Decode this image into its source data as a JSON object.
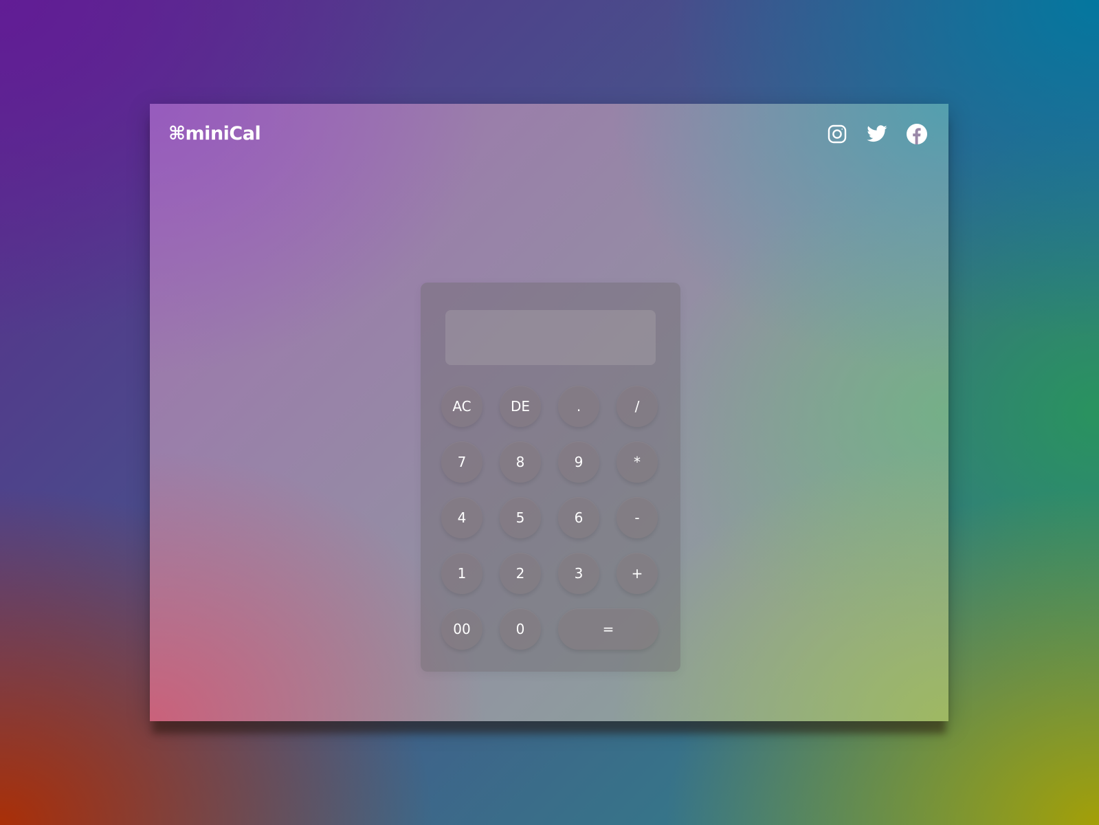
{
  "header": {
    "brand": "⌘miniCal",
    "social": [
      {
        "name": "instagram-icon"
      },
      {
        "name": "twitter-icon"
      },
      {
        "name": "facebook-icon"
      }
    ]
  },
  "calculator": {
    "display_value": "",
    "keys": {
      "ac": "AC",
      "de": "DE",
      "dot": ".",
      "divide": "/",
      "seven": "7",
      "eight": "8",
      "nine": "9",
      "multiply": "*",
      "four": "4",
      "five": "5",
      "six": "6",
      "minus": "-",
      "one": "1",
      "two": "2",
      "three": "3",
      "plus": "+",
      "double_zero": "00",
      "zero": "0",
      "equals": "="
    }
  },
  "colors": {
    "text": "#ffffff"
  }
}
